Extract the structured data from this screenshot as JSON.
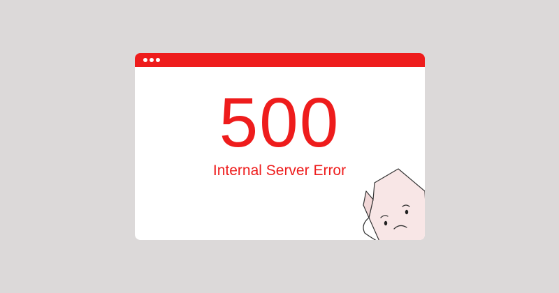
{
  "error": {
    "code": "500",
    "message": "Internal Server Error"
  },
  "window": {
    "title_dots": [
      "dot",
      "dot",
      "dot"
    ]
  },
  "icons": {
    "sad_page": "sad-document-icon"
  },
  "colors": {
    "background": "#dcd9d9",
    "accent": "#ee1c1c",
    "window": "#ffffff"
  }
}
